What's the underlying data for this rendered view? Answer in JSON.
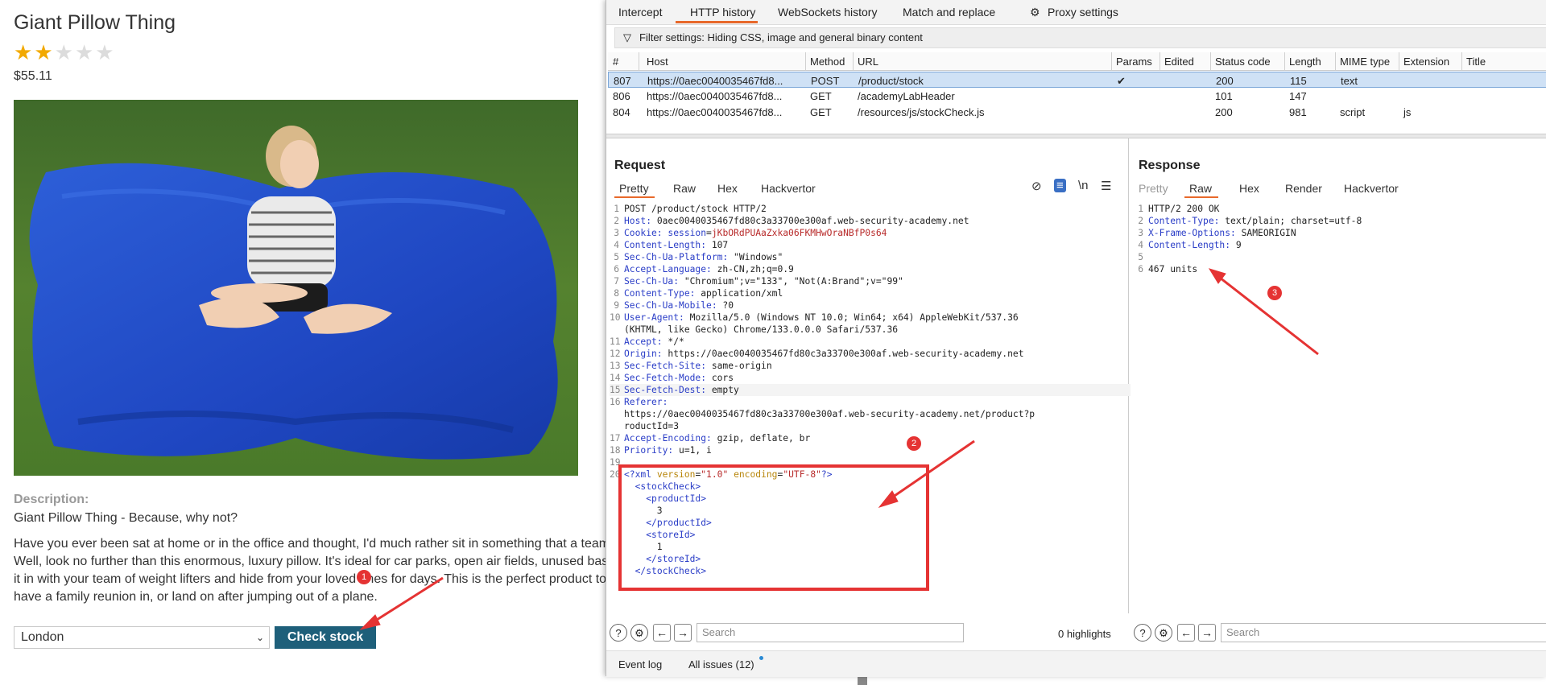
{
  "shop": {
    "title": "Giant Pillow Thing",
    "rating": 2,
    "rating_max": 5,
    "price": "$55.11",
    "description_heading": "Description:",
    "tagline": "Giant Pillow Thing - Because, why not?",
    "body_lines": [
      "Have you ever been sat at home or in the office and thought, I'd much rather sit in something that a team",
      "Well, look no further than this enormous, luxury pillow. It's ideal for car parks, open air fields, unused bas",
      "it in with your team of weight lifters and hide from your loved ones for days. This is the perfect product to",
      "have a family reunion in, or land on after jumping out of a plane."
    ],
    "store_select": "London",
    "check_button": "Check stock"
  },
  "burp": {
    "tabs": [
      "Intercept",
      "HTTP history",
      "WebSockets history",
      "Match and replace",
      "Proxy settings"
    ],
    "filter": "Filter settings: Hiding CSS, image and general binary content",
    "columns": [
      "#",
      "Host",
      "Method",
      "URL",
      "Params",
      "Edited",
      "Status code",
      "Length",
      "MIME type",
      "Extension",
      "Title"
    ],
    "rows": [
      {
        "id": "807",
        "host": "https://0aec0040035467fd8...",
        "method": "POST",
        "url": "/product/stock",
        "params": "✔",
        "status": "200",
        "length": "115",
        "mime": "text",
        "ext": ""
      },
      {
        "id": "806",
        "host": "https://0aec0040035467fd8...",
        "method": "GET",
        "url": "/academyLabHeader",
        "params": "",
        "status": "101",
        "length": "147",
        "mime": "",
        "ext": ""
      },
      {
        "id": "804",
        "host": "https://0aec0040035467fd8...",
        "method": "GET",
        "url": "/resources/js/stockCheck.js",
        "params": "",
        "status": "200",
        "length": "981",
        "mime": "script",
        "ext": "js"
      }
    ],
    "request": {
      "title": "Request",
      "tabs": [
        "Pretty",
        "Raw",
        "Hex",
        "Hackvertor"
      ],
      "search_placeholder": "Search",
      "highlights": "0 highlights"
    },
    "response": {
      "title": "Response",
      "tabs": [
        "Pretty",
        "Raw",
        "Hex",
        "Render",
        "Hackvertor"
      ],
      "search_placeholder": "Search",
      "lines": [
        {
          "n": "1",
          "k": "",
          "v": "HTTP/2 200 OK"
        },
        {
          "n": "2",
          "k": "Content-Type:",
          "v": " text/plain; charset=utf-8"
        },
        {
          "n": "3",
          "k": "X-Frame-Options:",
          "v": " SAMEORIGIN"
        },
        {
          "n": "4",
          "k": "Content-Length:",
          "v": " 9"
        },
        {
          "n": "5",
          "k": "",
          "v": ""
        },
        {
          "n": "6",
          "k": "",
          "v": "467 units"
        }
      ]
    },
    "status": {
      "event_log": "Event log",
      "issues": "All issues (12)"
    }
  },
  "annotations": [
    "1",
    "2",
    "3"
  ]
}
